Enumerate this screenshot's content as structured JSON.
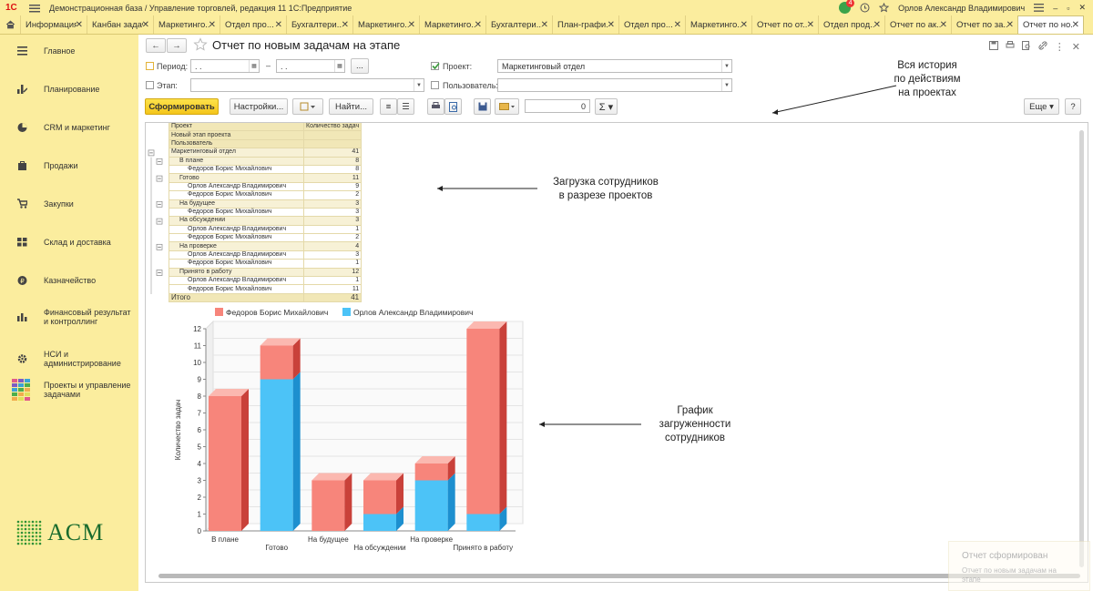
{
  "window": {
    "title": "Демонстрационная база / Управление торговлей, редакция 11 1С:Предприятие",
    "user": "Орлов Александр Владимирович",
    "notifications": "4"
  },
  "tabs": [
    {
      "label": "Информация"
    },
    {
      "label": "Канбан задач"
    },
    {
      "label": "Маркетинго..."
    },
    {
      "label": "Отдел про..."
    },
    {
      "label": "Бухгалтери..."
    },
    {
      "label": "Маркетинго..."
    },
    {
      "label": "Маркетинго..."
    },
    {
      "label": "Бухгалтери..."
    },
    {
      "label": "План-графи..."
    },
    {
      "label": "Отдел про..."
    },
    {
      "label": "Маркетинго..."
    },
    {
      "label": "Отчет по от..."
    },
    {
      "label": "Отдел прод..."
    },
    {
      "label": "Отчет по ак..."
    },
    {
      "label": "Отчет по за..."
    },
    {
      "label": "Отчет по но..."
    }
  ],
  "sidebar": {
    "items": [
      {
        "label": "Главное",
        "icon": "menu-lines-icon"
      },
      {
        "label": "Планирование",
        "icon": "planning-icon"
      },
      {
        "label": "CRM и маркетинг",
        "icon": "pie-icon"
      },
      {
        "label": "Продажи",
        "icon": "bag-icon"
      },
      {
        "label": "Закупки",
        "icon": "cart-icon"
      },
      {
        "label": "Склад и доставка",
        "icon": "warehouse-icon"
      },
      {
        "label": "Казначейство",
        "icon": "coin-icon"
      },
      {
        "label": "Финансовый результат и контроллинг",
        "icon": "bar-icon"
      },
      {
        "label": "НСИ и администрирование",
        "icon": "gear-icon"
      },
      {
        "label": "Проекты и управление задачами",
        "icon": "projects-icon"
      }
    ],
    "logo_text": "ACM"
  },
  "form": {
    "title": "Отчет по новым задачам на этапе",
    "period_label": "Период:",
    "period_from": " .  .    ",
    "period_dash": "–",
    "period_to": " .  .    ",
    "ellipsis": "...",
    "stage_label": "Этап:",
    "project_label": "Проект:",
    "project_value": "Маркетинговый отдел",
    "user_label": "Пользователь:",
    "generate_btn": "Сформировать",
    "settings_btn": "Настройки...",
    "find_btn": "Найти...",
    "sum_value": "0",
    "more_btn": "Еще",
    "help_btn": "?"
  },
  "table": {
    "headers": [
      [
        "Проект",
        "Количество задач"
      ],
      [
        "Новый этап проекта",
        ""
      ],
      [
        "Пользователь",
        ""
      ]
    ],
    "rows": [
      {
        "indent": 0,
        "label": "Маркетинговый отдел",
        "value": "41",
        "kind": "grp"
      },
      {
        "indent": 1,
        "label": "В плане",
        "value": "8",
        "kind": "grp"
      },
      {
        "indent": 2,
        "label": "Федоров Борис Михайлович",
        "value": "8",
        "kind": "row"
      },
      {
        "indent": 1,
        "label": "Готово",
        "value": "11",
        "kind": "grp"
      },
      {
        "indent": 2,
        "label": "Орлов Александр Владимирович",
        "value": "9",
        "kind": "row"
      },
      {
        "indent": 2,
        "label": "Федоров Борис Михайлович",
        "value": "2",
        "kind": "row"
      },
      {
        "indent": 1,
        "label": "На будущее",
        "value": "3",
        "kind": "grp"
      },
      {
        "indent": 2,
        "label": "Федоров Борис Михайлович",
        "value": "3",
        "kind": "row"
      },
      {
        "indent": 1,
        "label": "На обсуждении",
        "value": "3",
        "kind": "grp"
      },
      {
        "indent": 2,
        "label": "Орлов Александр Владимирович",
        "value": "1",
        "kind": "row"
      },
      {
        "indent": 2,
        "label": "Федоров Борис Михайлович",
        "value": "2",
        "kind": "row"
      },
      {
        "indent": 1,
        "label": "На проверке",
        "value": "4",
        "kind": "grp"
      },
      {
        "indent": 2,
        "label": "Орлов Александр Владимирович",
        "value": "3",
        "kind": "row"
      },
      {
        "indent": 2,
        "label": "Федоров Борис Михайлович",
        "value": "1",
        "kind": "row"
      },
      {
        "indent": 1,
        "label": "Принято в работу",
        "value": "12",
        "kind": "grp"
      },
      {
        "indent": 2,
        "label": "Орлов Александр Владимирович",
        "value": "1",
        "kind": "row"
      },
      {
        "indent": 2,
        "label": "Федоров Борис Михайлович",
        "value": "11",
        "kind": "row"
      }
    ],
    "total_label": "Итого",
    "total_value": "41"
  },
  "chart_data": {
    "type": "bar",
    "stacked": true,
    "ylabel": "Количество задач",
    "ylim": [
      0,
      12
    ],
    "yticks": [
      0,
      1,
      2,
      3,
      4,
      5,
      6,
      7,
      8,
      9,
      10,
      11,
      12
    ],
    "categories": [
      "В плане",
      "Готово",
      "На будущее",
      "На обсуждении",
      "На проверке",
      "Принято в работу"
    ],
    "series": [
      {
        "name": "Федоров Борис Михайлович",
        "color": "#f7857b",
        "values": [
          8,
          2,
          3,
          2,
          1,
          11
        ]
      },
      {
        "name": "Орлов Александр Владимирович",
        "color": "#4cc3f7",
        "values": [
          0,
          9,
          0,
          1,
          3,
          1
        ]
      }
    ],
    "legend": "top",
    "grid": true
  },
  "annotations": [
    {
      "text": "Вся история\nпо действиям\nна проектах"
    },
    {
      "text": "Загрузка сотрудников\nв разрезе проектов"
    },
    {
      "text": "График\nзагруженности\nсотрудников"
    }
  ],
  "toast": {
    "title": "Отчет сформирован",
    "text": "Отчет по новым задачам на этапе"
  }
}
